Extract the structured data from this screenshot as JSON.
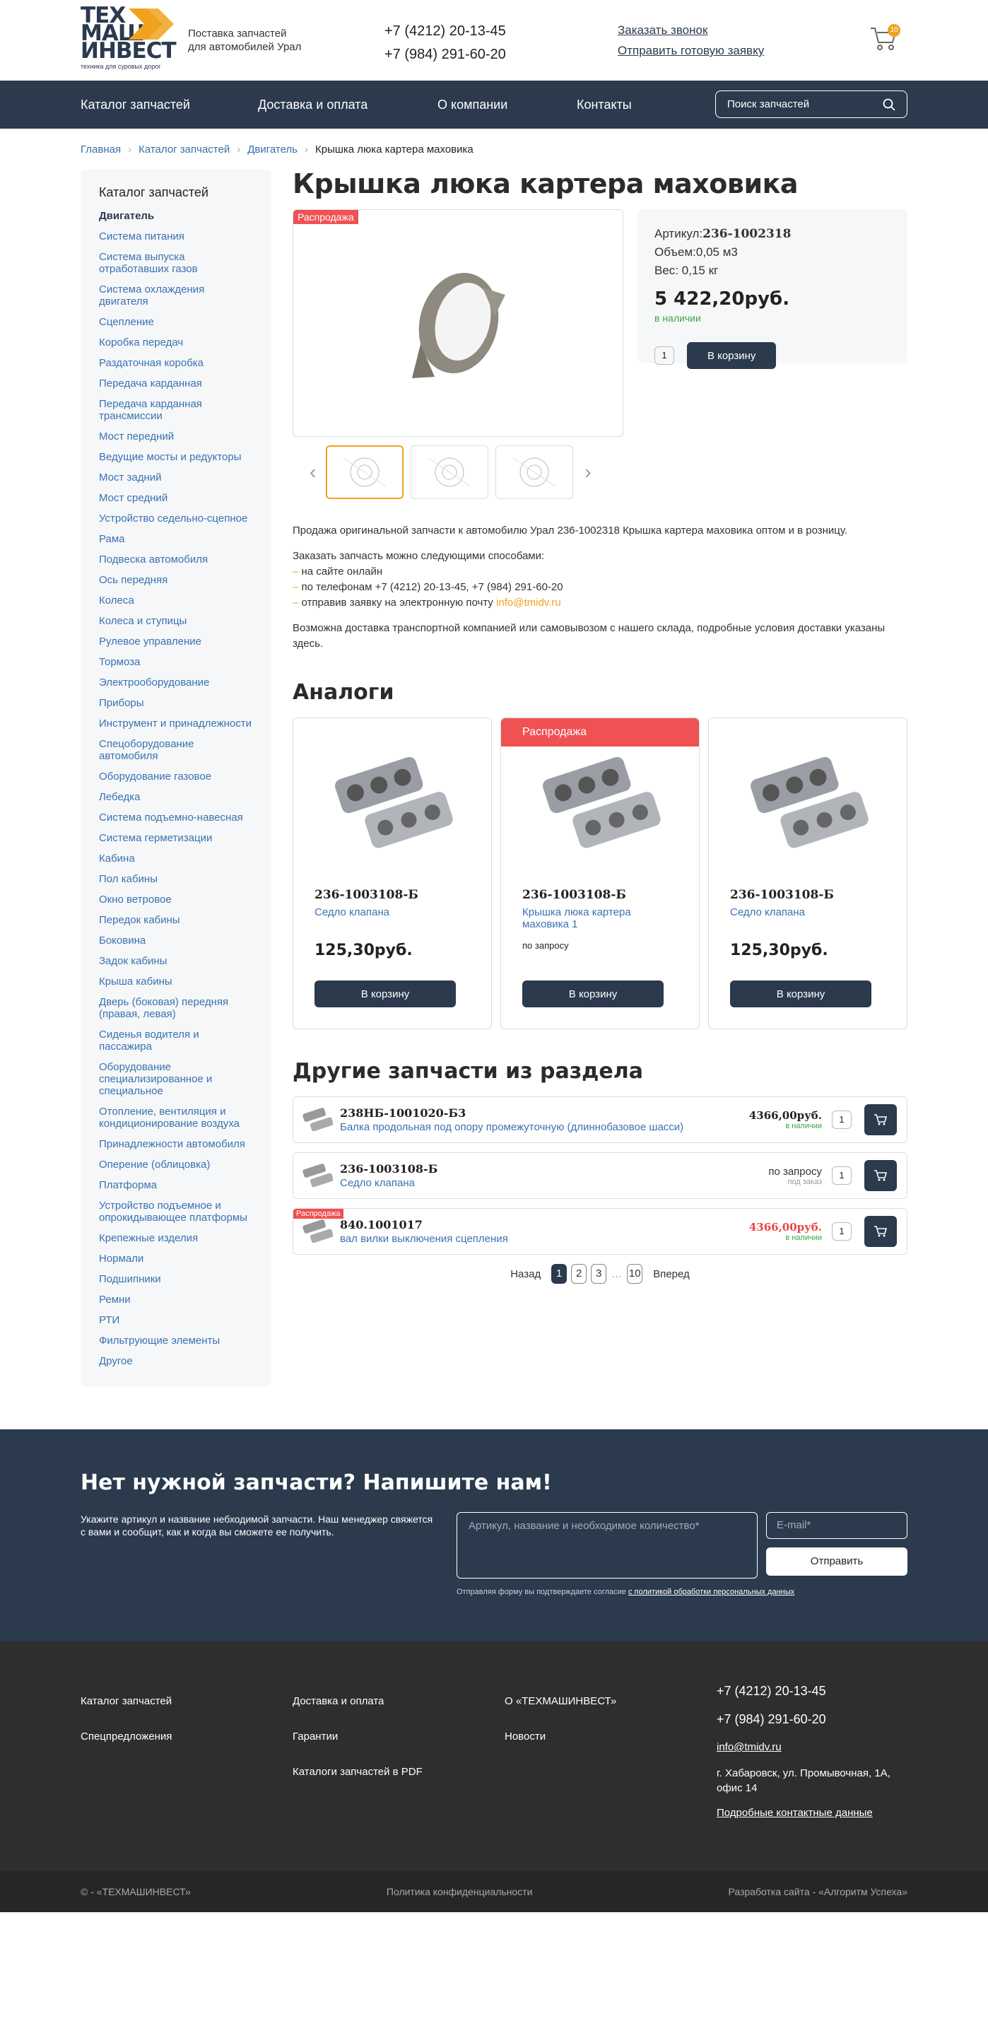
{
  "header": {
    "logo": {
      "line1": "ТЕХ",
      "line2": "МАШ",
      "line3": "ИНВЕСТ",
      "tagline": "техника для суровых дорог"
    },
    "slogan_line1": "Поставка запчастей",
    "slogan_line2": "для автомобилей Урал",
    "phone1": "+7 (4212) 20-13-45",
    "phone2": "+7 (984) 291-60-20",
    "callback": "Заказать звонок",
    "send_request": "Отправить готовую заявку",
    "cart_count": "10"
  },
  "nav": {
    "items": [
      "Каталог запчастей",
      "Доставка и оплата",
      "О компании",
      "Контакты"
    ],
    "search_placeholder": "Поиск запчастей"
  },
  "breadcrumbs": [
    "Главная",
    "Каталог запчастей",
    "Двигатель",
    "Крышка люка картера маховика"
  ],
  "sidebar": {
    "title": "Каталог запчастей",
    "items": [
      "Двигатель",
      "Система питания",
      "Система выпуска отработавших газов",
      "Система охлаждения двигателя",
      "Сцепление",
      "Коробка передач",
      "Раздаточная коробка",
      "Передача карданная",
      "Передача карданная трансмиссии",
      "Мост передний",
      "Ведущие мосты и редукторы",
      "Мост задний",
      "Мост средний",
      "Устройство седельно-сцепное",
      "Рама",
      "Подвеска автомобиля",
      "Ось передняя",
      "Колеса",
      "Колеса и ступицы",
      "Рулевое управление",
      "Тормоза",
      "Электрооборудование",
      "Приборы",
      "Инструмент и принадлежности",
      "Спецоборудование автомобиля",
      "Оборудование газовое",
      "Лебедка",
      "Система подъемно-навесная",
      "Система герметизации",
      "Кабина",
      "Пол кабины",
      "Окно ветровое",
      "Передок кабины",
      "Боковина",
      "Задок кабины",
      "Крыша кабины",
      "Дверь (боковая) передняя (правая, левая)",
      "Сиденья водителя и пассажира",
      "Оборудование специализированное и специальное",
      "Отопление, вентиляция и кондиционирование воздуха",
      "Принадлежности автомобиля",
      "Оперение (облицовка)",
      "Платформа",
      "Устройство подъемное и опрокидывающее платформы",
      "Крепежные изделия",
      "Нормали",
      "Подшипники",
      "Ремни",
      "РТИ",
      "Фильтрующие элементы",
      "Другое"
    ]
  },
  "product": {
    "title": "Крышка люка картера маховика",
    "sale_label": "Распродажа",
    "article_label": "Артикул:",
    "article": "236-1002318",
    "volume_label": "Объем:",
    "volume": "0,05 м3",
    "weight_label": "Вес:",
    "weight": "0,15 кг",
    "price": "5 422,20руб.",
    "availability": "в наличии",
    "qty": "1",
    "cart_button": "В корзину"
  },
  "description": {
    "p1": "Продажа оригинальной запчасти к автомобилю Урал 236-1002318 Крышка картера маховика оптом и в розницу.",
    "ways_title": "Заказать запчасть можно следующими способами:",
    "way1": "на сайте онлайн",
    "way2": "по телефонам +7 (4212) 20-13-45, +7 (984) 291-60-20",
    "way3": "отправив заявку на электронную почту ",
    "email": "info@tmidv.ru",
    "p3": "Возможна доставка транспортной компанией или самовывозом с нашего склада, подробные условия доставки указаны здесь."
  },
  "analogs": {
    "title": "Аналоги",
    "cards": [
      {
        "article": "236-1003108-Б",
        "name": "Седло клапана",
        "price": "125,30руб.",
        "button": "В корзину"
      },
      {
        "sale": "Распродажа",
        "article": "236-1003108-Б",
        "name": "Крышка люка картера маховика 1",
        "price": "по запросу",
        "button": "В корзину"
      },
      {
        "article": "236-1003108-Б",
        "name": "Седло клапана",
        "price": "125,30руб.",
        "button": "В корзину"
      }
    ]
  },
  "others": {
    "title": "Другие запчасти из раздела",
    "rows": [
      {
        "article": "238НБ-1001020-Б3",
        "name": "Балка продольная под опору промежуточную (длиннобазовое шасси)",
        "price": "4366,00руб.",
        "status": "в наличии",
        "qty": "1"
      },
      {
        "article": "236-1003108-Б",
        "name": "Седло клапана",
        "price": "по запросу",
        "status": "под заказ",
        "qty": "1"
      },
      {
        "sale": "Распродажа",
        "article": "840.1001017",
        "name": "вал вилки выключения сцепления",
        "price": "4366,00руб.",
        "status": "в наличии",
        "qty": "1"
      }
    ]
  },
  "pager": {
    "prev": "Назад",
    "pages": [
      "1",
      "2",
      "3"
    ],
    "dots": "…",
    "last": "10",
    "next": "Вперед"
  },
  "feedback": {
    "title": "Нет нужной запчасти? Напишите нам!",
    "text": "Укажите артикул и название небходимой запчасти. Наш менеджер свяжется с вами и сообщит, как и когда вы сможете ее получить.",
    "textarea_placeholder": "Артикул, название и необходимое количество*",
    "email_placeholder": "E-mail*",
    "send": "Отправить",
    "agree": "Отправляя форму вы подтверждаете согласие ",
    "agree_link": "с политикой обработки персональных данных"
  },
  "footer": {
    "col1": [
      "Каталог запчастей",
      "Спецпредложения"
    ],
    "col2": [
      "Доставка и оплата",
      "Гарантии",
      "Каталоги запчастей в PDF"
    ],
    "col3": [
      "О «ТЕХМАШИНВЕСТ»",
      "Новости"
    ],
    "phone1": "+7 (4212) 20-13-45",
    "phone2": "+7 (984) 291-60-20",
    "email": "info@tmidv.ru",
    "address": "г. Хабаровск, ул. Промывочная, 1А, офис 14",
    "contacts": "Подробные контактные данные",
    "copyright": "© - «ТЕХМАШИНВЕСТ»",
    "privacy": "Политика конфиденциальности",
    "developer": "Разработка сайта - «Алгоритм Успеха»"
  }
}
